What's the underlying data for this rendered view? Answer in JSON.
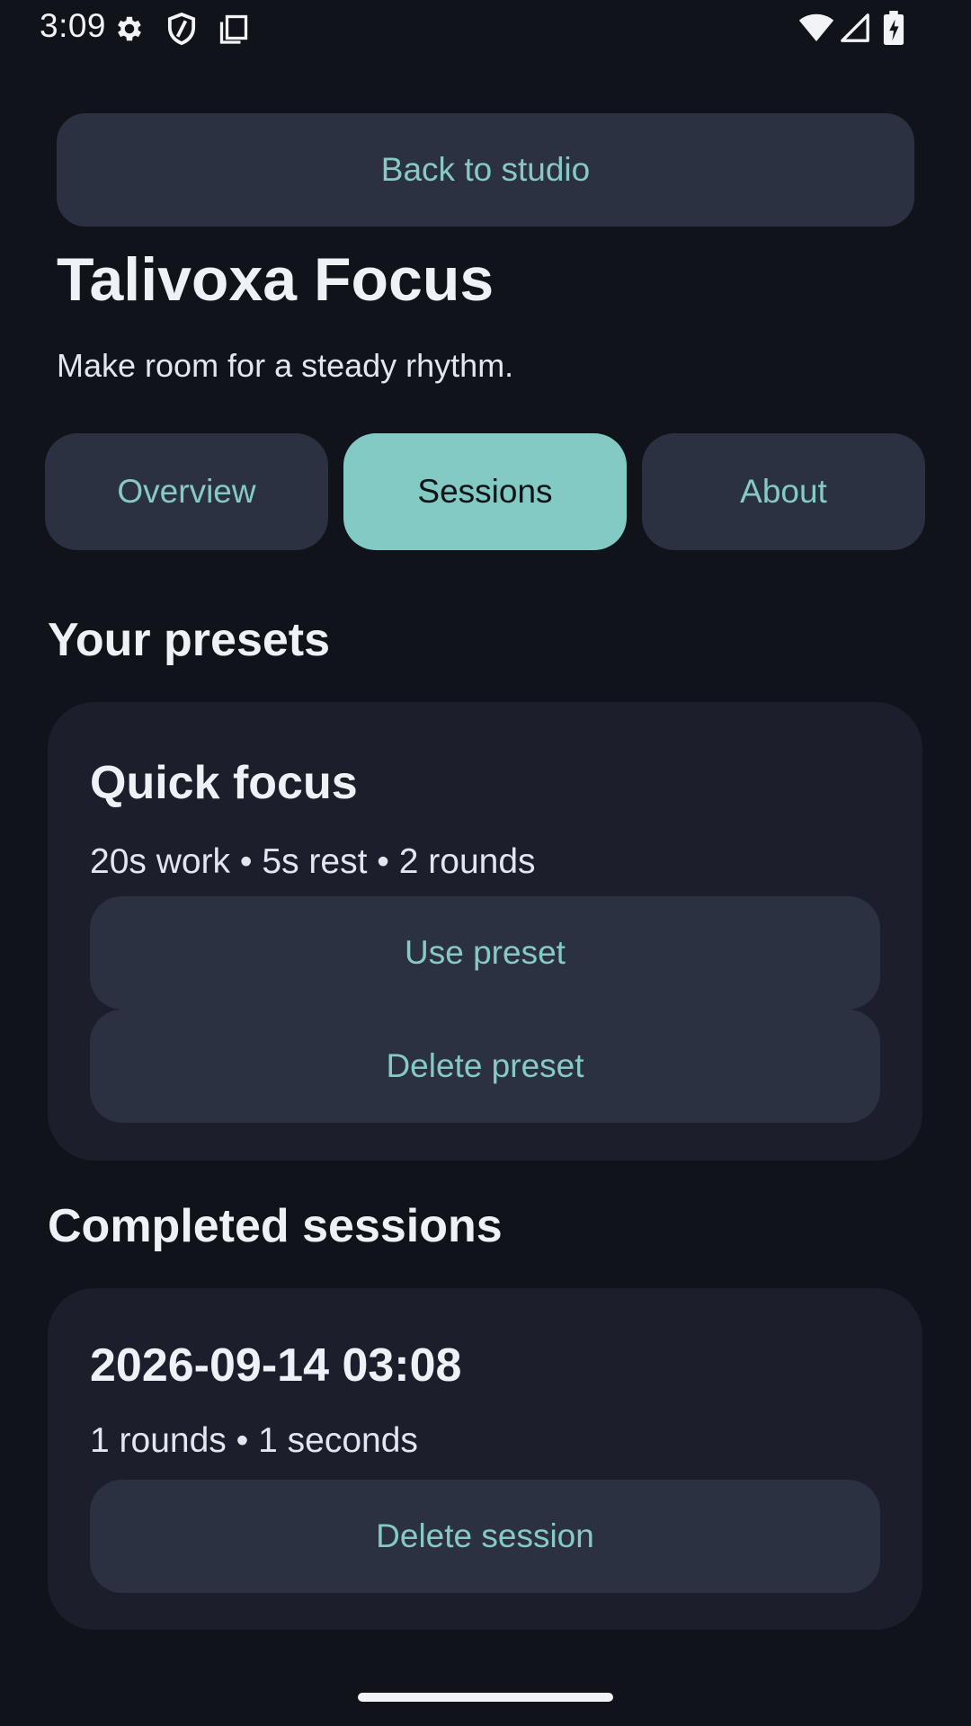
{
  "status_bar": {
    "time": "3:09",
    "icons_left": [
      "gear-icon",
      "shield-icon",
      "copy-icon"
    ],
    "icons_right": [
      "wifi-icon",
      "signal-icon",
      "battery-charging-icon"
    ]
  },
  "header": {
    "back_label": "Back to studio",
    "title": "Talivoxa Focus",
    "subtitle": "Make room for a steady rhythm."
  },
  "tabs": [
    {
      "label": "Overview",
      "active": false
    },
    {
      "label": "Sessions",
      "active": true
    },
    {
      "label": "About",
      "active": false
    }
  ],
  "presets": {
    "heading": "Your presets",
    "items": [
      {
        "title": "Quick focus",
        "meta": "20s work • 5s rest • 2 rounds",
        "use_label": "Use preset",
        "delete_label": "Delete preset"
      }
    ]
  },
  "sessions": {
    "heading": "Completed sessions",
    "items": [
      {
        "title": "2026-09-14 03:08",
        "meta": "1 rounds • 1 seconds",
        "delete_label": "Delete session"
      }
    ]
  },
  "colors": {
    "background": "#10131a",
    "card": "#1c1f2b",
    "button": "#2c3142",
    "accent": "#86cbc3",
    "active_tab": "#82cac3"
  }
}
